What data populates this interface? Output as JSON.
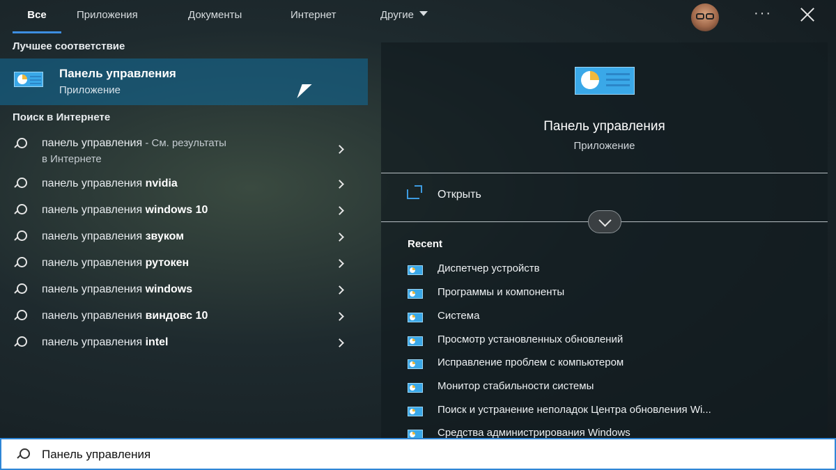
{
  "tabs": {
    "all": "Все",
    "apps": "Приложения",
    "docs": "Документы",
    "web": "Интернет",
    "other": "Другие"
  },
  "icons": {
    "more": "more-options-icon",
    "close": "close-icon",
    "search": "search-icon",
    "chevron": "chevron-right-icon",
    "app": "control-panel-icon",
    "open": "open-icon",
    "expand": "chevron-down-icon"
  },
  "colors": {
    "accent": "#3d8ee0",
    "selection": "#14648c"
  },
  "best_match": {
    "label": "Лучшее соответствие",
    "title": "Панель управления",
    "subtitle": "Приложение"
  },
  "web_search": {
    "label": "Поиск в Интернете",
    "items": [
      {
        "prefix": "панель управления",
        "bold": "",
        "suffix": " - См. результаты",
        "line2": "в Интернете"
      },
      {
        "prefix": "панель управления ",
        "bold": "nvidia"
      },
      {
        "prefix": "панель управления ",
        "bold": "windows 10"
      },
      {
        "prefix": "панель управления ",
        "bold": "звуком"
      },
      {
        "prefix": "панель управления ",
        "bold": "рутокен"
      },
      {
        "prefix": "панель управления ",
        "bold": "windows"
      },
      {
        "prefix": "панель управления ",
        "bold": "виндовс 10"
      },
      {
        "prefix": "панель управления ",
        "bold": "intel"
      }
    ]
  },
  "preview": {
    "title": "Панель управления",
    "subtitle": "Приложение",
    "open_label": "Открыть",
    "recent_label": "Recent",
    "recent": [
      "Диспетчер устройств",
      "Программы и компоненты",
      "Система",
      "Просмотр установленных обновлений",
      "Исправление проблем с компьютером",
      "Монитор стабильности системы",
      "Поиск и устранение неполадок Центра обновления Wi...",
      "Средства администрирования Windows"
    ]
  },
  "search": {
    "value": "Панель управления"
  }
}
